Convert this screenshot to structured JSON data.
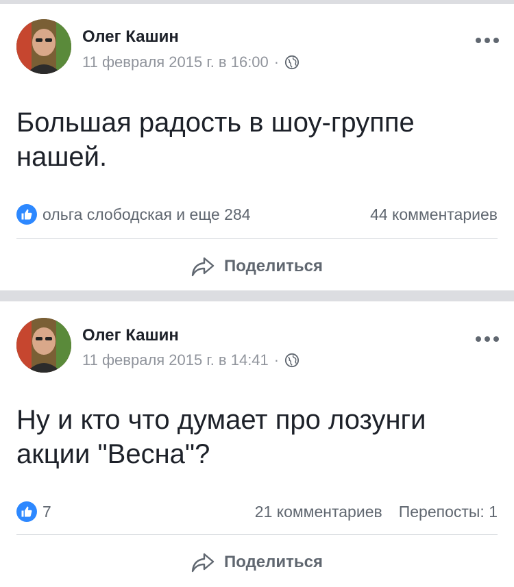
{
  "posts": [
    {
      "author": "Олег Кашин",
      "date": "11 февраля 2015 г. в 16:00",
      "dot": "·",
      "text": "Большая радость в шоу-группе нашей.",
      "likes_text": "ольга слободская и еще 284",
      "comments": "44 комментариев",
      "reposts": "",
      "share_label": "Поделиться"
    },
    {
      "author": "Олег Кашин",
      "date": "11 февраля 2015 г. в 14:41",
      "dot": "·",
      "text": "Ну и кто что думает про лозунги акции \"Весна\"?",
      "likes_text": "7",
      "comments": "21 комментариев",
      "reposts": "Перепосты: 1",
      "share_label": "Поделиться"
    }
  ],
  "icons": {
    "like": "like-icon",
    "globe": "globe-icon",
    "more": "more-icon",
    "share": "share-icon"
  },
  "colors": {
    "like_blue": "#2d88ff",
    "divider": "#dcdde1",
    "meta_gray": "#90949c",
    "text_dark": "#1d2129"
  }
}
